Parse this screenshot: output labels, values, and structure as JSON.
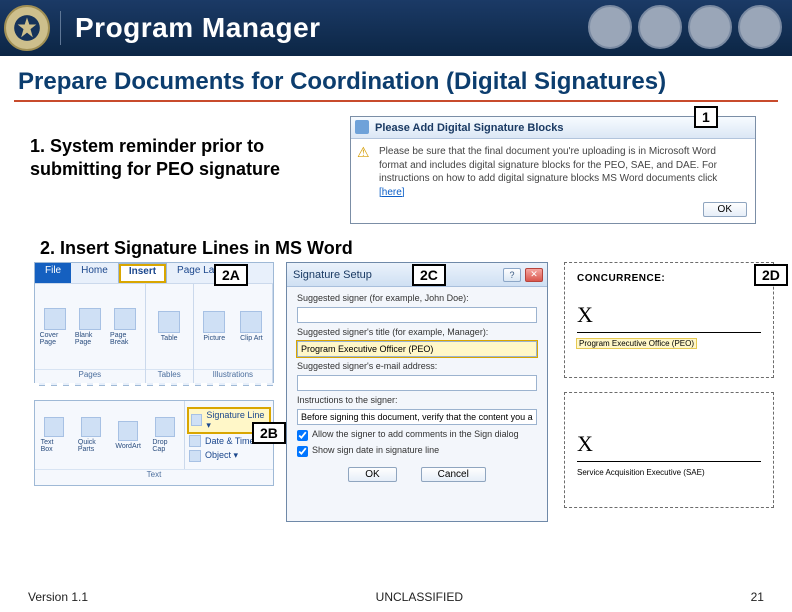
{
  "header": {
    "title": "Program Manager"
  },
  "title": "Prepare Documents for Coordination (Digital Signatures)",
  "callouts": {
    "c1": "1",
    "c2a": "2A",
    "c2b": "2B",
    "c2c": "2C",
    "c2d": "2D"
  },
  "step1_label": "1.  System reminder prior to submitting for PEO signature",
  "step2_label": "2.  Insert Signature Lines in MS Word",
  "dlg1": {
    "title": "Please Add Digital Signature Blocks",
    "body_pre": "Please be sure that the final document you're uploading is in Microsoft Word format and includes digital signature blocks for the PEO, SAE, and DAE. For instructions on how to add digital signature blocks MS Word documents click ",
    "link": "[here]",
    "ok": "OK"
  },
  "ribbon": {
    "tabs": {
      "file": "File",
      "home": "Home",
      "insert": "Insert",
      "pagelayout": "Page Layout"
    },
    "icons": {
      "cover": "Cover Page",
      "blank": "Blank Page",
      "break": "Page Break",
      "table": "Table",
      "picture": "Picture",
      "clipart": "Clip Art"
    },
    "groups": {
      "pages": "Pages",
      "tables": "Tables",
      "illus": "Illustrations"
    }
  },
  "textgrp": {
    "icons": {
      "textbox": "Text Box",
      "quick": "Quick Parts",
      "wordart": "WordArt",
      "dropcap": "Drop Cap"
    },
    "menu": {
      "sigline": "Signature Line ▾",
      "datetime": "Date & Time",
      "object": "Object ▾"
    },
    "label": "Text"
  },
  "dlg2": {
    "title": "Signature Setup",
    "help": "?",
    "close": "✕",
    "l_signer": "Suggested signer (for example, John Doe):",
    "l_title": "Suggested signer's title (for example, Manager):",
    "v_title": "Program Executive Officer (PEO)",
    "l_email": "Suggested signer's e-mail address:",
    "l_instr": "Instructions to the signer:",
    "v_instr": "Before signing this document, verify that the content you are signing is correct.",
    "chk1": "Allow the signer to add comments in the Sign dialog",
    "chk2": "Show sign date in signature line",
    "ok": "OK",
    "cancel": "Cancel"
  },
  "sig": {
    "concur": "CONCURRENCE:",
    "x": "X",
    "role1": "Program Executive Office (PEO)",
    "role2": "Service Acquisition Executive (SAE)"
  },
  "footer": {
    "version": "Version 1.1",
    "class": "UNCLASSIFIED",
    "page": "21"
  }
}
